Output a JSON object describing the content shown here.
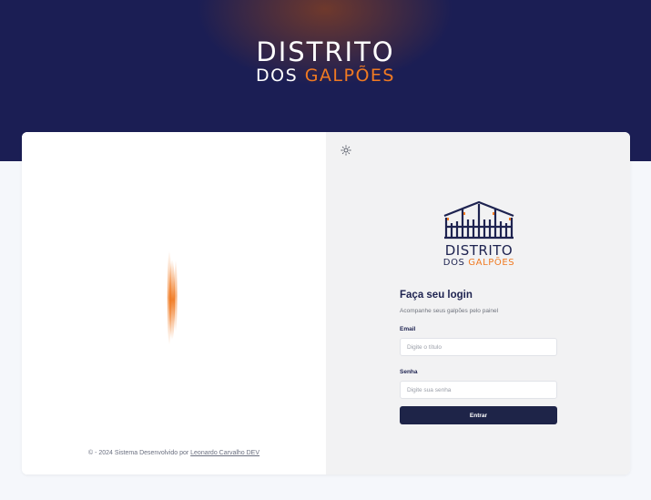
{
  "hero": {
    "brand_line1": "DISTRITO",
    "brand_line2_a": "DOS ",
    "brand_line2_b": "GALPÕES"
  },
  "footer": {
    "text": "© - 2024 Sistema Desenvolvido por ",
    "link": "Leonardo Carvalho DEV"
  },
  "login": {
    "logo_line1": "DISTRITO",
    "logo_line2_a": "DOS ",
    "logo_line2_b": "GALPÕES",
    "title": "Faça seu login",
    "subtitle": "Acompanhe seus galpões pelo painel",
    "email_label": "Email",
    "email_placeholder": "Digite o título",
    "email_value": "",
    "password_label": "Senha",
    "password_placeholder": "Digite sua senha",
    "password_value": "",
    "submit_label": "Entrar"
  },
  "icons": {
    "theme_toggle": "sun-icon",
    "logo": "warehouse-icon",
    "decoration": "flare-icon"
  },
  "colors": {
    "navy": "#1b1e54",
    "accent": "#f07a22",
    "button": "#1e2448"
  }
}
